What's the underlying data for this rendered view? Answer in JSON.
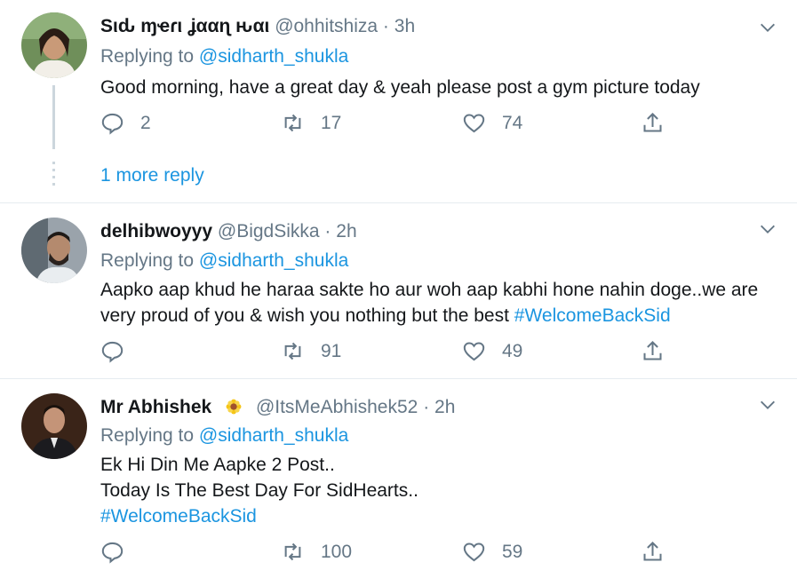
{
  "tweets": [
    {
      "name": "Sιԃ ɱҽɾι ʝααɳ ԋαι",
      "handle": "@ohhitshiza",
      "dot": "·",
      "time": "3h",
      "replying_label": "Replying to",
      "replying_to": "@sidharth_shukla",
      "text": "Good morning, have a great day & yeah please post a gym picture today",
      "replies": "2",
      "retweets": "17",
      "likes": "74",
      "more_reply": "1 more reply"
    },
    {
      "name": "delhibwoyyy",
      "handle": "@BigdSikka",
      "dot": "·",
      "time": "2h",
      "replying_label": "Replying to",
      "replying_to": "@sidharth_shukla",
      "text": "Aapko aap khud he haraa sakte ho aur woh aap kabhi hone nahin doge..we are very proud of you & wish you nothing but the best",
      "hashtag": "#WelcomeBackSid",
      "replies": "",
      "retweets": "91",
      "likes": "49"
    },
    {
      "name": "Mr Abhishek",
      "handle": "@ItsMeAbhishek52",
      "dot": "·",
      "time": "2h",
      "replying_label": "Replying to",
      "replying_to": "@sidharth_shukla",
      "text_line1": "Ek Hi Din Me Aapke 2 Post..",
      "text_line2": "Today Is The Best Day For SidHearts..",
      "hashtag": "#WelcomeBackSid",
      "replies": "",
      "retweets": "100",
      "likes": "59"
    }
  ],
  "colors": {
    "link": "#1b95e0",
    "secondary": "#657786",
    "border": "#e6ecf0",
    "thread": "#ccd6dd"
  }
}
